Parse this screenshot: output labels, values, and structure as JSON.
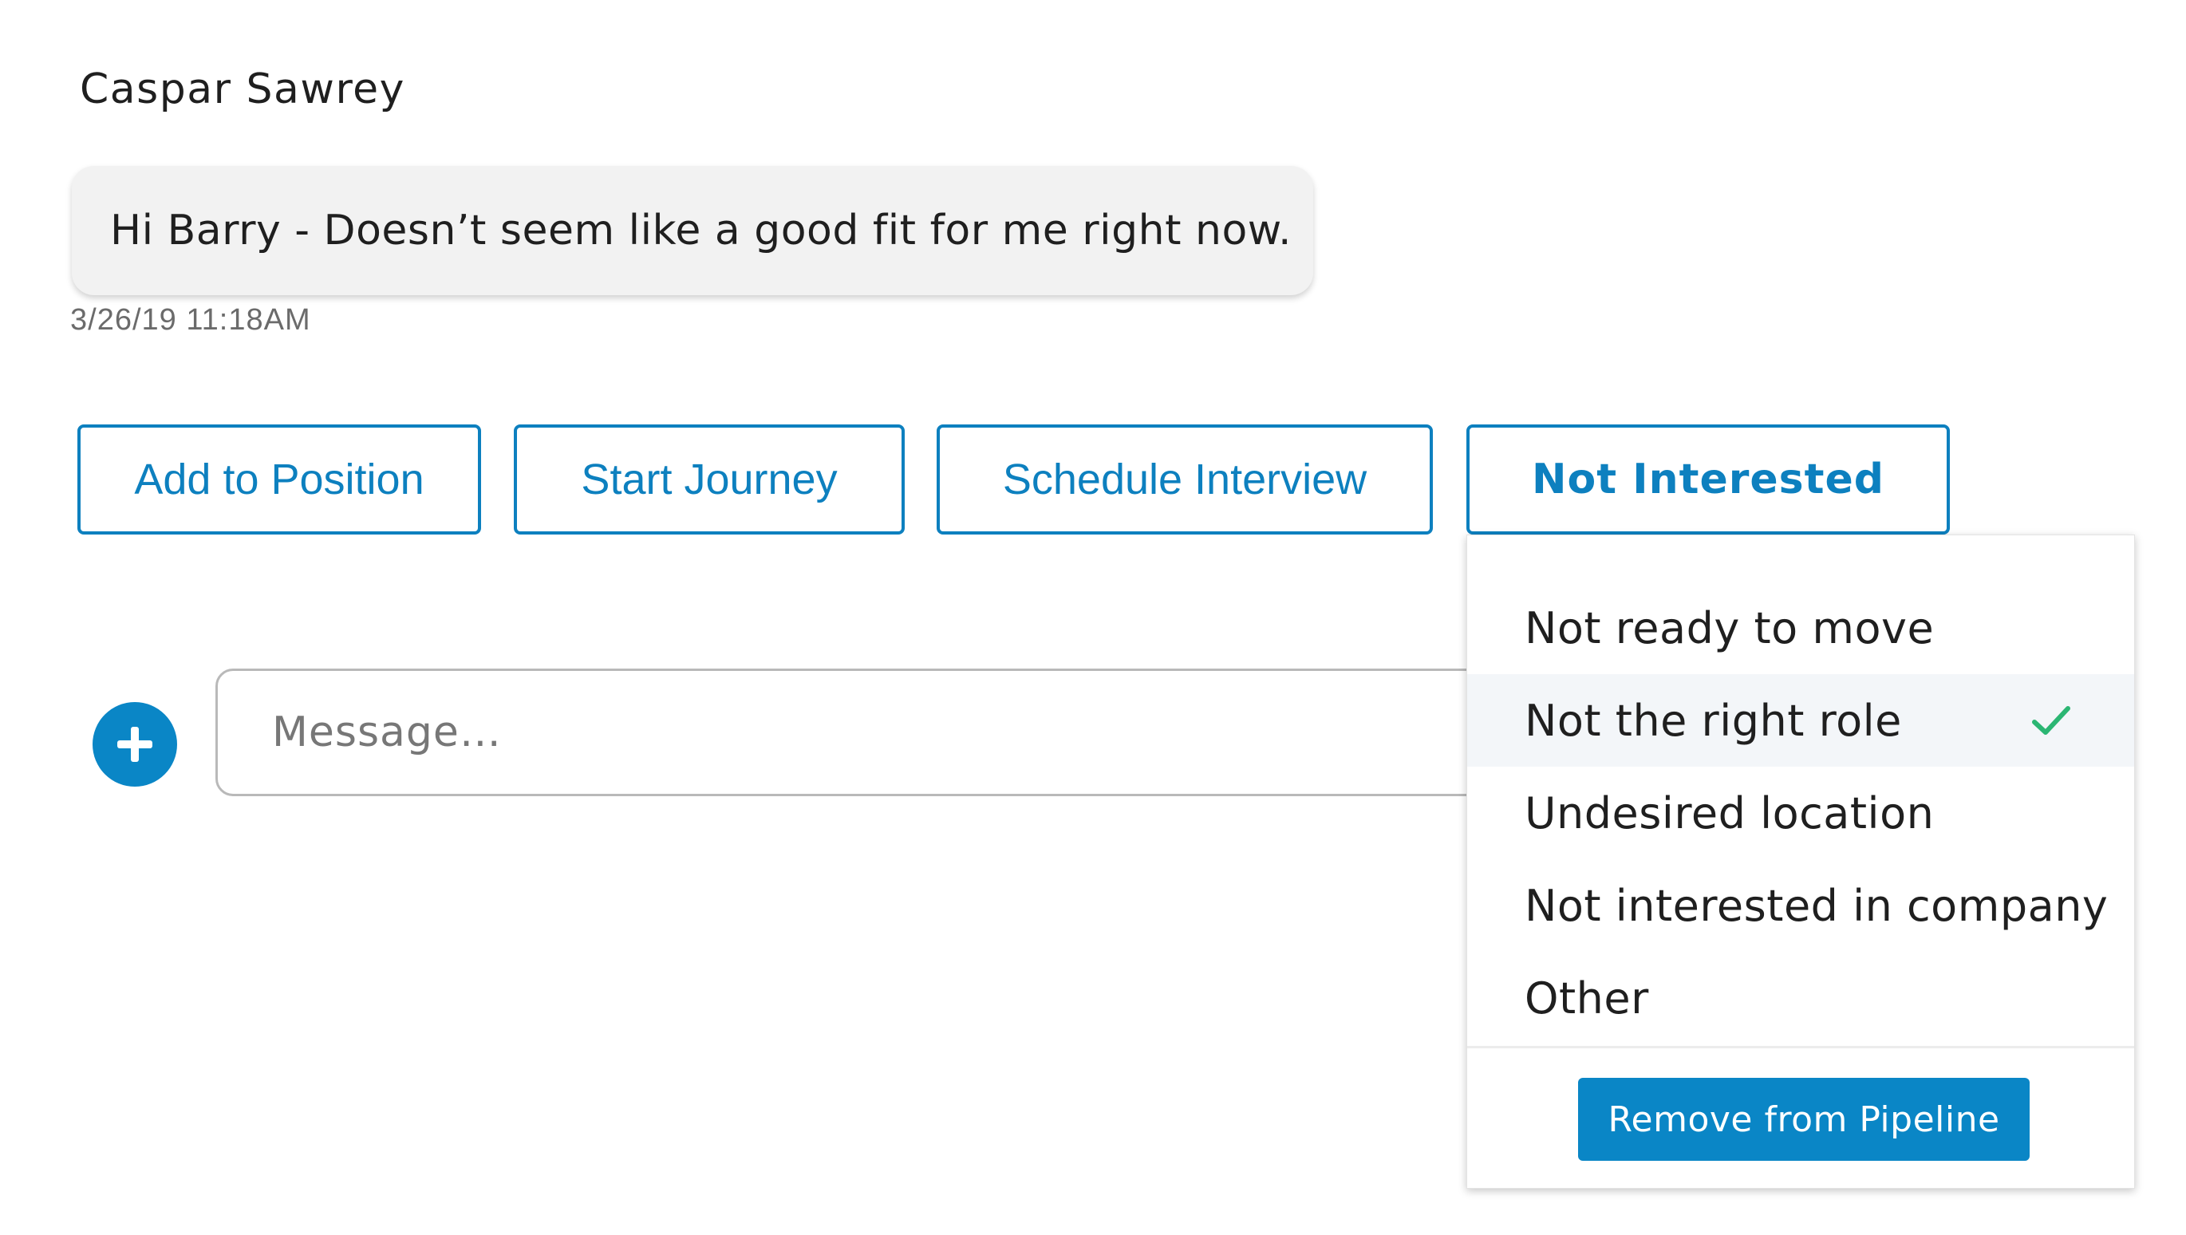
{
  "conversation": {
    "sender_name": "Caspar Sawrey",
    "message_text": "Hi Barry - Doesn’t seem like a good fit for me right now.",
    "timestamp": "3/26/19 11:18AM"
  },
  "actions": {
    "add_to_position": "Add to Position",
    "start_journey": "Start Journey",
    "schedule_interview": "Schedule Interview",
    "not_interested": "Not Interested"
  },
  "composer": {
    "add_icon": "plus-icon",
    "placeholder": "Message…",
    "value": ""
  },
  "not_interested_menu": {
    "options": [
      {
        "label": "Not ready to move",
        "selected": false
      },
      {
        "label": "Not the right role",
        "selected": true
      },
      {
        "label": "Undesired location",
        "selected": false
      },
      {
        "label": "Not interested in company",
        "selected": false
      },
      {
        "label": "Other",
        "selected": false
      }
    ],
    "selected_icon": "check-icon",
    "remove_label": "Remove from Pipeline"
  },
  "colors": {
    "accent": "#0a86c6",
    "check": "#2bb673",
    "bubble": "#f2f2f2"
  }
}
